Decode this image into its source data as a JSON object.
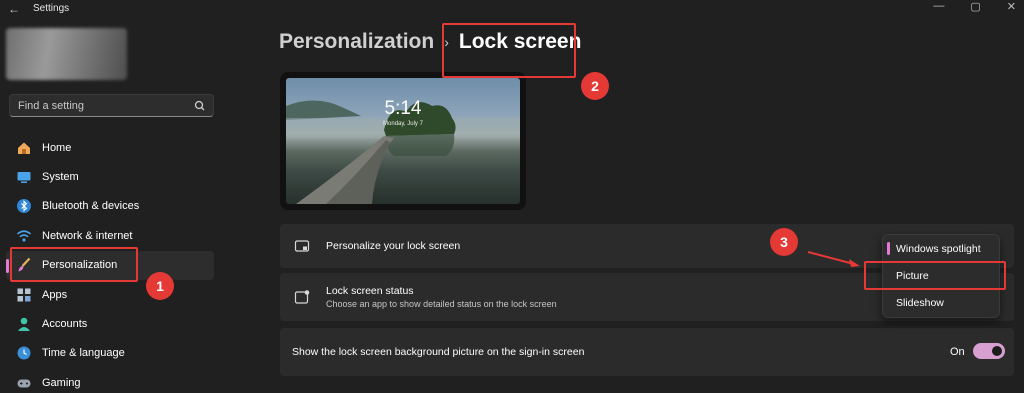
{
  "window": {
    "title": "Settings",
    "back_glyph": "←",
    "controls": [
      "—",
      "▢",
      "✕"
    ]
  },
  "sidebar": {
    "search_placeholder": "Find a setting",
    "items": [
      {
        "label": "Home",
        "icon": "home-icon"
      },
      {
        "label": "System",
        "icon": "system-icon"
      },
      {
        "label": "Bluetooth & devices",
        "icon": "bluetooth-icon"
      },
      {
        "label": "Network & internet",
        "icon": "wifi-icon"
      },
      {
        "label": "Personalization",
        "icon": "brush-icon",
        "active": true
      },
      {
        "label": "Apps",
        "icon": "apps-icon"
      },
      {
        "label": "Accounts",
        "icon": "accounts-icon"
      },
      {
        "label": "Time & language",
        "icon": "time-language-icon"
      },
      {
        "label": "Gaming",
        "icon": "gaming-icon"
      }
    ]
  },
  "breadcrumb": {
    "parent": "Personalization",
    "separator": "›",
    "current": "Lock screen"
  },
  "preview": {
    "time": "5:14",
    "date": "Monday, July 7"
  },
  "settings": {
    "personalize_title": "Personalize your lock screen",
    "status_title": "Lock screen status",
    "status_subtitle": "Choose an app to show detailed status on the lock screen",
    "signin_title": "Show the lock screen background picture on the sign-in screen",
    "signin_toggle_label": "On",
    "signin_toggle_on": true
  },
  "dropdown": {
    "options": [
      "Windows spotlight",
      "Picture",
      "Slideshow"
    ],
    "selected": "Windows spotlight"
  },
  "annotations": {
    "badge1": "1",
    "badge2": "2",
    "badge3": "3",
    "color": "#e53935"
  },
  "colors": {
    "accent": "#e27bd5",
    "background": "#202020",
    "card": "#2b2b2b"
  }
}
